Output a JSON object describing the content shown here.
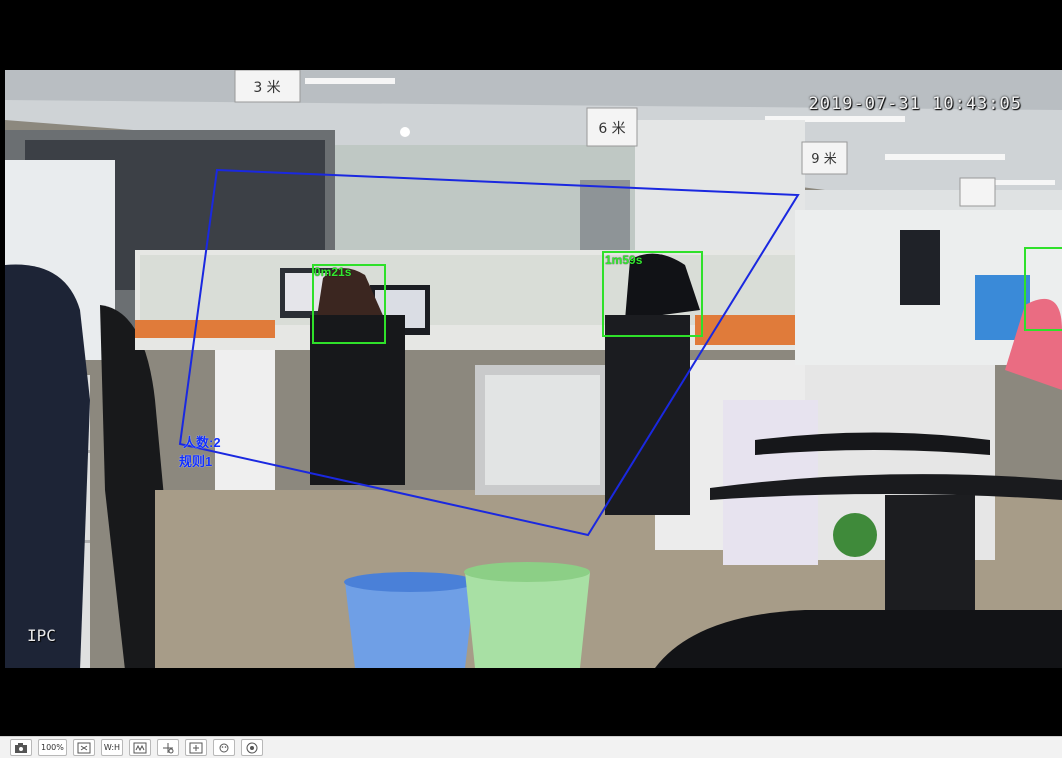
{
  "osd": {
    "timestamp": "2019-07-31 10:43:05",
    "camera_name": "IPC"
  },
  "detections": [
    {
      "label": "0m21s"
    },
    {
      "label": "1m59s"
    }
  ],
  "rule": {
    "count_label": "人数:2",
    "rule_name": "规则1"
  },
  "signs": [
    "3 米",
    "6 米",
    "9 米"
  ],
  "toolbar": {
    "buttons": [
      {
        "name": "snapshot",
        "label": ""
      },
      {
        "name": "zoom-100",
        "label": "100%"
      },
      {
        "name": "fit-window",
        "label": ""
      },
      {
        "name": "aspect-ratio",
        "label": "W:H"
      },
      {
        "name": "stream-select",
        "label": ""
      },
      {
        "name": "ptz-control",
        "label": ""
      },
      {
        "name": "digital-zoom",
        "label": ""
      },
      {
        "name": "face-detect",
        "label": ""
      },
      {
        "name": "fullscreen",
        "label": ""
      }
    ]
  },
  "colors": {
    "rule_outline": "#1a28e0",
    "detection_box": "#2fe02a"
  }
}
